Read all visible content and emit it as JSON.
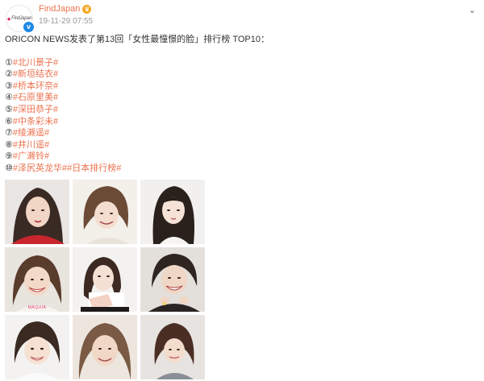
{
  "post": {
    "username": "FindJapan",
    "vip_icon": "vip-crown-icon",
    "avatar_text": "FindJapan",
    "timestamp": "19-11-29 07:55",
    "more_icon": "chevron-down-icon",
    "headline": "ORICON NEWS发表了第13回「女性最憧憬的脸」排行榜 TOP10：",
    "ranking": [
      {
        "mark": "①",
        "tag": "#北川景子#"
      },
      {
        "mark": "②",
        "tag": "#新垣结衣#"
      },
      {
        "mark": "③",
        "tag": "#桥本环奈#"
      },
      {
        "mark": "④",
        "tag": "#石原里美#"
      },
      {
        "mark": "⑤",
        "tag": "#深田恭子#"
      },
      {
        "mark": "⑥",
        "tag": "#中条彩未#"
      },
      {
        "mark": "⑦",
        "tag": "#绫濑遥#"
      },
      {
        "mark": "⑧",
        "tag": "#井川遥#"
      },
      {
        "mark": "⑨",
        "tag": "#广濑铃#"
      },
      {
        "mark": "⑩",
        "tag": "#泽尻英龙华##日本排行榜#"
      }
    ],
    "image_caption": "MAQUIA",
    "colors": {
      "accent": "#eb7350",
      "verified": "#1e88e5",
      "text": "#333333",
      "muted": "#999999"
    }
  }
}
